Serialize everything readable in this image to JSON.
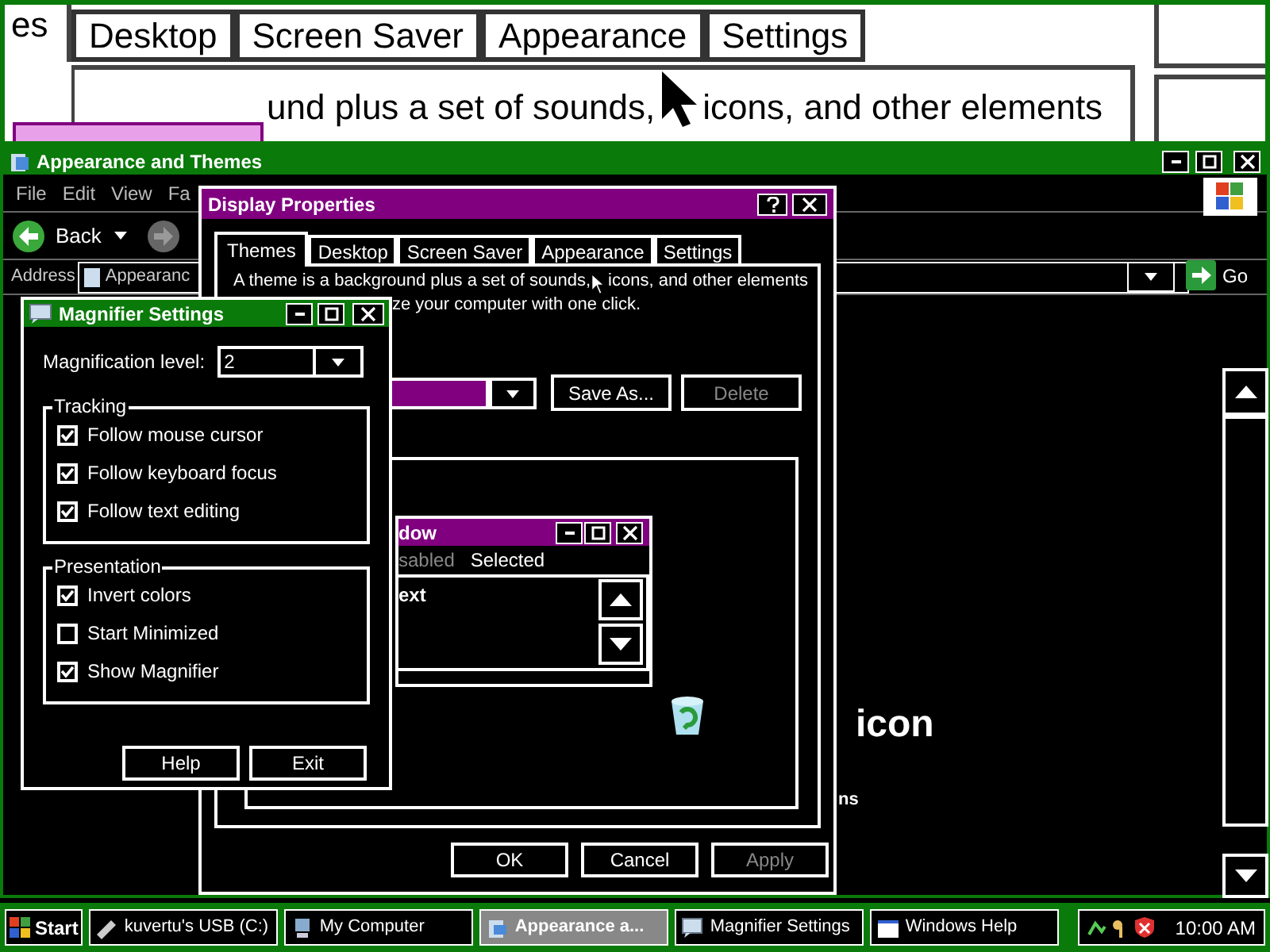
{
  "magnifier_view": {
    "tabs": [
      {
        "label": "es",
        "selected": true
      },
      {
        "label": "Desktop",
        "selected": false
      },
      {
        "label": "Screen Saver",
        "selected": false
      },
      {
        "label": "Appearance",
        "selected": false
      },
      {
        "label": "Settings",
        "selected": false
      }
    ],
    "text": "und plus a set of sounds, icons, and other elements"
  },
  "explorer": {
    "title": "Appearance and Themes",
    "menu": [
      "File",
      "Edit",
      "View",
      "Fa"
    ],
    "back": "Back",
    "address_label": "Address",
    "address_value": "Appearanc",
    "go": "Go",
    "heading": "icon",
    "text": "ns"
  },
  "display_properties": {
    "title": "Display Properties",
    "tabs": [
      {
        "label": "Themes",
        "selected": true
      },
      {
        "label": "Desktop",
        "selected": false
      },
      {
        "label": "Screen Saver",
        "selected": false
      },
      {
        "label": "Appearance",
        "selected": false
      },
      {
        "label": "Settings",
        "selected": false
      }
    ],
    "description": [
      "A theme is a background plus a set of sounds, icons, and other elements",
      "ze your computer with one click."
    ],
    "theme_buttons": [
      {
        "label": "Save As...",
        "disabled": false
      },
      {
        "label": "Delete",
        "disabled": true
      }
    ],
    "preview": {
      "title": "dow",
      "menu": [
        {
          "label": "sabled",
          "disabled": true
        },
        {
          "label": "Selected",
          "disabled": false
        }
      ],
      "text": "ext"
    },
    "buttons": [
      {
        "label": "OK",
        "disabled": false
      },
      {
        "label": "Cancel",
        "disabled": false
      },
      {
        "label": "Apply",
        "disabled": true
      }
    ]
  },
  "magnifier": {
    "title": "Magnifier Settings",
    "level_label": "Magnification level:",
    "level_value": "2",
    "groups": [
      {
        "title": "Tracking",
        "options": [
          {
            "label": "Follow mouse cursor",
            "checked": true
          },
          {
            "label": "Follow keyboard focus",
            "checked": true
          },
          {
            "label": "Follow text editing",
            "checked": true
          }
        ]
      },
      {
        "title": "Presentation",
        "options": [
          {
            "label": "Invert colors",
            "checked": true
          },
          {
            "label": "Start Minimized",
            "checked": false
          },
          {
            "label": "Show Magnifier",
            "checked": true
          }
        ]
      }
    ],
    "buttons": [
      "Help",
      "Exit"
    ]
  },
  "taskbar": {
    "start": "Start",
    "items": [
      {
        "label": "kuvertu's USB (C:)",
        "selected": false
      },
      {
        "label": "My Computer",
        "selected": false
      },
      {
        "label": "Appearance a...",
        "selected": true
      },
      {
        "label": "Magnifier Settings",
        "selected": false
      },
      {
        "label": "Windows Help",
        "selected": false
      }
    ],
    "clock": "10:00 AM"
  }
}
